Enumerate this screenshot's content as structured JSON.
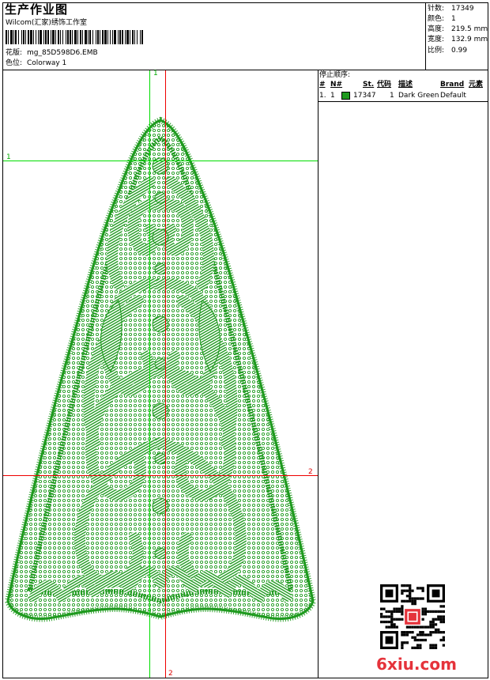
{
  "header": {
    "title": "生产作业图",
    "company": "Wilcom(汇家)绣饰工作室",
    "design_label": "花版:",
    "design_name": "mg_85D598D6.EMB",
    "colorway_label": "色位:",
    "colorway_name": "Colorway 1"
  },
  "stats": {
    "stitches_label": "针数:",
    "stitches_value": "17349",
    "colors_label": "颜色:",
    "colors_value": "1",
    "height_label": "高度:",
    "height_value": "219.5 mm",
    "width_label": "宽度:",
    "width_value": "132.9 mm",
    "scale_label": "比例:",
    "scale_value": "0.99"
  },
  "legend": {
    "title": "停止顺序:",
    "columns": {
      "num": "#",
      "n": "N#",
      "stitches": "St.",
      "code": "代码",
      "desc": "描述",
      "brand": "Brand",
      "elem": "元素"
    },
    "rows": [
      {
        "num": "1.",
        "n": "1",
        "color": "#1f9a1f",
        "stitches": "17347",
        "code": "1",
        "desc": "Dark Green",
        "brand": "Default"
      }
    ]
  },
  "guides": {
    "green_v_label": "1",
    "green_h_label": "1",
    "red_h_label": "2",
    "red_v_label": "2"
  },
  "design": {
    "thread_color": "#1f9a1f",
    "guide_green": "#00dd00",
    "guide_red": "#ee0000"
  },
  "watermark": {
    "text": "6xiu.com",
    "color": "#e5333b"
  }
}
